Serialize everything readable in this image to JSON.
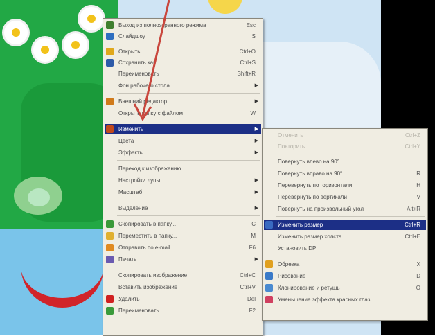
{
  "main_menu": {
    "items": [
      {
        "label": "Выход из полноэкранного режима",
        "shortcut": "Esc",
        "icon": "fullscreen-exit-icon",
        "icon_color": "#3f7f2f"
      },
      {
        "label": "Слайдшоу",
        "shortcut": "S",
        "icon": "slideshow-icon",
        "icon_color": "#2f6fc0"
      },
      {
        "label": "Открыть",
        "shortcut": "Ctrl+O",
        "icon": "open-folder-icon",
        "icon_color": "#e0a81c"
      },
      {
        "label": "Сохранить как...",
        "shortcut": "Ctrl+S",
        "icon": "save-icon",
        "icon_color": "#2d5aa8"
      },
      {
        "label": "Переименовать",
        "shortcut": "Shift+R",
        "icon": "",
        "icon_color": ""
      },
      {
        "label": "Фон рабочего стола",
        "shortcut": "",
        "icon": "",
        "icon_color": ""
      },
      {
        "label": "Внешний редактор",
        "shortcut": "",
        "icon": "external-editor-icon",
        "icon_color": "#d07a1a"
      },
      {
        "label": "Открыть папку с файлом",
        "shortcut": "W",
        "icon": "",
        "icon_color": ""
      },
      {
        "label": "Изменить",
        "shortcut": "",
        "icon": "edit-icon",
        "icon_color": "#c24a1c"
      },
      {
        "label": "Цвета",
        "shortcut": "",
        "icon": "",
        "icon_color": ""
      },
      {
        "label": "Эффекты",
        "shortcut": "",
        "icon": "",
        "icon_color": ""
      },
      {
        "label": "Переход к изображению",
        "shortcut": "",
        "icon": "",
        "icon_color": ""
      },
      {
        "label": "Настройки лупы",
        "shortcut": "",
        "icon": "",
        "icon_color": ""
      },
      {
        "label": "Масштаб",
        "shortcut": "",
        "icon": "",
        "icon_color": ""
      },
      {
        "label": "Выделение",
        "shortcut": "",
        "icon": "",
        "icon_color": ""
      },
      {
        "label": "Скопировать в папку...",
        "shortcut": "C",
        "icon": "copy-to-folder-icon",
        "icon_color": "#3a9a3a"
      },
      {
        "label": "Переместить в папку...",
        "shortcut": "M",
        "icon": "move-to-folder-icon",
        "icon_color": "#e0b030"
      },
      {
        "label": "Отправить по e-mail",
        "shortcut": "F6",
        "icon": "email-icon",
        "icon_color": "#e08a20"
      },
      {
        "label": "Печать",
        "shortcut": "",
        "icon": "print-icon",
        "icon_color": "#6a5ab0"
      },
      {
        "label": "Скопировать изображение",
        "shortcut": "Ctrl+C",
        "icon": "",
        "icon_color": ""
      },
      {
        "label": "Вставить изображение",
        "shortcut": "Ctrl+V",
        "icon": "",
        "icon_color": ""
      },
      {
        "label": "Удалить",
        "shortcut": "Del",
        "icon": "delete-icon",
        "icon_color": "#d02020"
      },
      {
        "label": "Переименовать",
        "shortcut": "F2",
        "icon": "rename-icon",
        "icon_color": "#3a9a3a"
      }
    ]
  },
  "sub_menu": {
    "items": [
      {
        "label": "Отменить",
        "shortcut": "Ctrl+Z",
        "icon": "",
        "icon_color": "",
        "disabled": true
      },
      {
        "label": "Повторить",
        "shortcut": "Ctrl+Y",
        "icon": "",
        "icon_color": "",
        "disabled": true
      },
      {
        "label": "Повернуть влево на 90°",
        "shortcut": "L",
        "icon": "",
        "icon_color": ""
      },
      {
        "label": "Повернуть вправо на 90°",
        "shortcut": "R",
        "icon": "",
        "icon_color": ""
      },
      {
        "label": "Перевернуть по горизонтали",
        "shortcut": "H",
        "icon": "",
        "icon_color": ""
      },
      {
        "label": "Перевернуть по вертикали",
        "shortcut": "V",
        "icon": "",
        "icon_color": ""
      },
      {
        "label": "Повернуть на произвольный угол",
        "shortcut": "Alt+R",
        "icon": "",
        "icon_color": ""
      },
      {
        "label": "Изменить размер",
        "shortcut": "Ctrl+R",
        "icon": "resize-icon",
        "icon_color": "#3a6ac0"
      },
      {
        "label": "Изменить размер холста",
        "shortcut": "Ctrl+E",
        "icon": "",
        "icon_color": ""
      },
      {
        "label": "Установить DPI",
        "shortcut": "",
        "icon": "",
        "icon_color": ""
      },
      {
        "label": "Обрезка",
        "shortcut": "X",
        "icon": "crop-icon",
        "icon_color": "#e0a020"
      },
      {
        "label": "Рисование",
        "shortcut": "D",
        "icon": "draw-icon",
        "icon_color": "#3a7ac8"
      },
      {
        "label": "Клонирование и ретушь",
        "shortcut": "O",
        "icon": "clone-icon",
        "icon_color": "#4a8ad0"
      },
      {
        "label": "Уменьшение эффекта красных глаз",
        "shortcut": "",
        "icon": "redeye-icon",
        "icon_color": "#d04060"
      }
    ]
  },
  "colors": {
    "selection": "#1c2f86",
    "menu_bg": "#f0ede2",
    "arrow": "#c9463c"
  }
}
